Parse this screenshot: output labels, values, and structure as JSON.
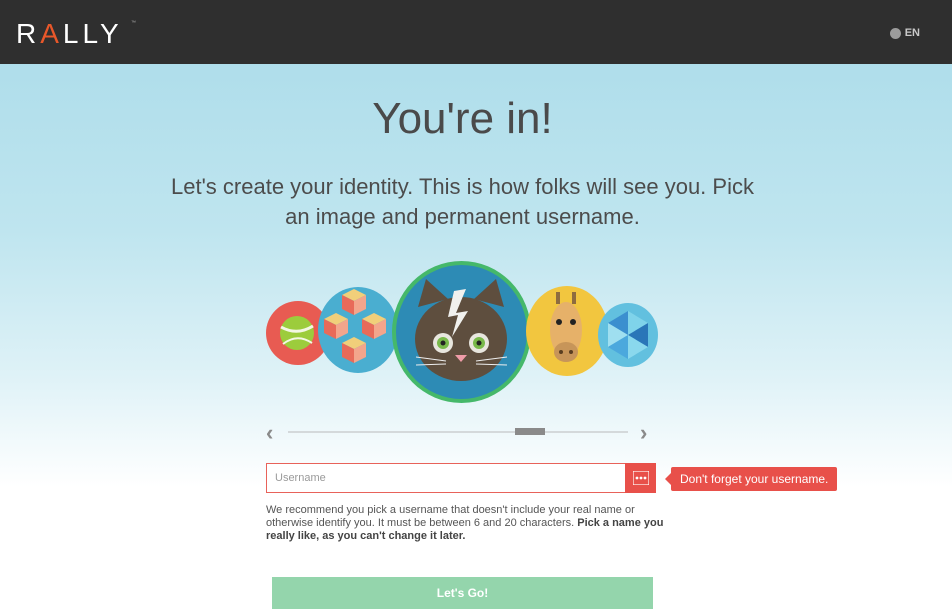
{
  "header": {
    "logo_prefix": "R",
    "logo_accent": "A",
    "logo_suffix": "LLY",
    "language": "EN",
    "language_icon": "globe-icon",
    "brand_color": "#e8572a",
    "bar_color": "#2f2f2f"
  },
  "main": {
    "headline": "You're in!",
    "subline": "Let's create your identity. This is how folks will see you. Pick an image and permanent username."
  },
  "avatar_picker": {
    "avatars": [
      "tennis-ball",
      "isometric-cubes",
      "cat",
      "giraffe",
      "blue-triangles"
    ],
    "selected": "cat",
    "prev_icon": "chevron-left-icon",
    "next_icon": "chevron-right-icon"
  },
  "username": {
    "placeholder": "Username",
    "value": "",
    "addon_icon": "password-dots-icon",
    "tooltip": "Don't forget your username.",
    "hint_prefix": "We recommend you pick a username that doesn't include your real name or otherwise identify you. It must be between 6 and 20 characters. ",
    "hint_bold": "Pick a name you really like, as you can't change it later.",
    "error_color": "#e8504a"
  },
  "cta": {
    "label": "Let's Go!",
    "color": "#94d5ac"
  }
}
